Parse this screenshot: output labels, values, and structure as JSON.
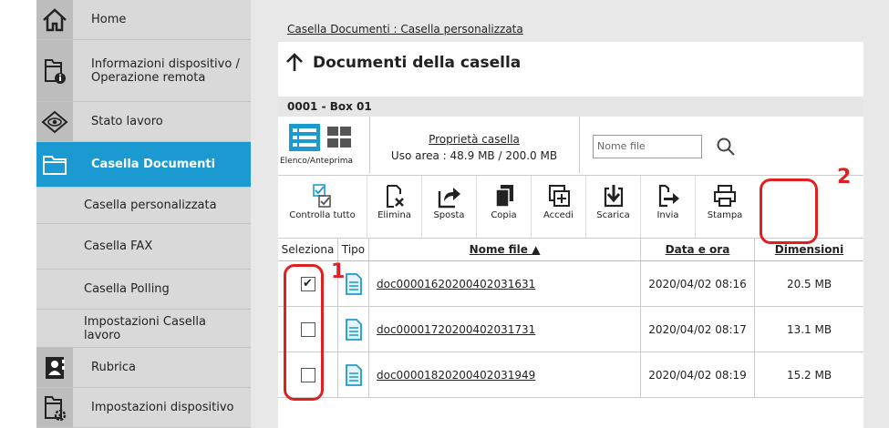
{
  "sidebar": {
    "items": [
      {
        "label": "Home",
        "icon": "home-icon"
      },
      {
        "label": "Informazioni dispositivo / Operazione remota",
        "icon": "device-info-icon"
      },
      {
        "label": "Stato lavoro",
        "icon": "eye-icon"
      },
      {
        "label": "Casella Documenti",
        "icon": "folder-icon"
      },
      {
        "label": "Casella personalizzata"
      },
      {
        "label": "Casella FAX"
      },
      {
        "label": "Casella Polling"
      },
      {
        "label": "Impostazioni Casella lavoro"
      },
      {
        "label": "Rubrica",
        "icon": "addressbook-icon"
      },
      {
        "label": "Impostazioni dispositivo",
        "icon": "device-settings-icon"
      }
    ]
  },
  "breadcrumb": "Casella Documenti : Casella personalizzata",
  "page_title": "Documenti della casella",
  "box_label": "0001 - Box 01",
  "view_label": "Elenco/Anteprima",
  "properties": {
    "link": "Proprietà casella",
    "usage": "Uso area : 48.9 MB / 200.0 MB"
  },
  "search": {
    "placeholder": "Nome file"
  },
  "toolbar": {
    "select_all": "Controlla tutto",
    "delete": "Elimina",
    "move": "Sposta",
    "copy": "Copia",
    "join": "Accedi",
    "download": "Scarica",
    "send": "Invia",
    "print": "Stampa"
  },
  "table": {
    "headers": {
      "select": "Seleziona",
      "type": "Tipo",
      "name": "Nome file ▲",
      "date": "Data e ora",
      "size": "Dimensioni"
    },
    "rows": [
      {
        "checked": "✔",
        "name": "doc00001620200402031631",
        "date": "2020/04/02 08:16",
        "size": "20.5 MB"
      },
      {
        "checked": "",
        "name": "doc00001720200402031731",
        "date": "2020/04/02 08:17",
        "size": "13.1 MB"
      },
      {
        "checked": "",
        "name": "doc00001820200402031949",
        "date": "2020/04/02 08:19",
        "size": "15.2 MB"
      }
    ]
  },
  "annotations": {
    "one": "1",
    "two": "2"
  },
  "colors": {
    "accent": "#1b9ad2",
    "highlight": "#e02020"
  }
}
